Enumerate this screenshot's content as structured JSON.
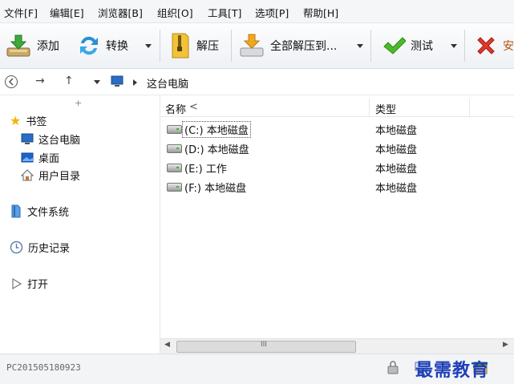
{
  "menu": [
    "文件[F]",
    "编辑[E]",
    "浏览器[B]",
    "组织[O]",
    "工具[T]",
    "选项[P]",
    "帮助[H]"
  ],
  "toolbar": {
    "add": "添加",
    "convert": "转换",
    "extract": "解压",
    "extract_all": "全部解压到...",
    "test": "测试"
  },
  "address": {
    "location": "这台电脑"
  },
  "sidebar": {
    "bookmarks": "书签",
    "this_pc": "这台电脑",
    "desktop": "桌面",
    "user_dir": "用户目录",
    "filesystem": "文件系统",
    "history": "历史记录",
    "open": "打开"
  },
  "columns": {
    "name": "名称",
    "type": "类型"
  },
  "drives": [
    {
      "name": "(C:) 本地磁盘",
      "type": "本地磁盘"
    },
    {
      "name": "(D:) 本地磁盘",
      "type": "本地磁盘"
    },
    {
      "name": "(E:) 工作",
      "type": "本地磁盘"
    },
    {
      "name": "(F:) 本地磁盘",
      "type": "本地磁盘"
    }
  ],
  "scroll_grip": "III",
  "status": {
    "computer": "PC201505180923"
  },
  "watermark": "最需教育"
}
